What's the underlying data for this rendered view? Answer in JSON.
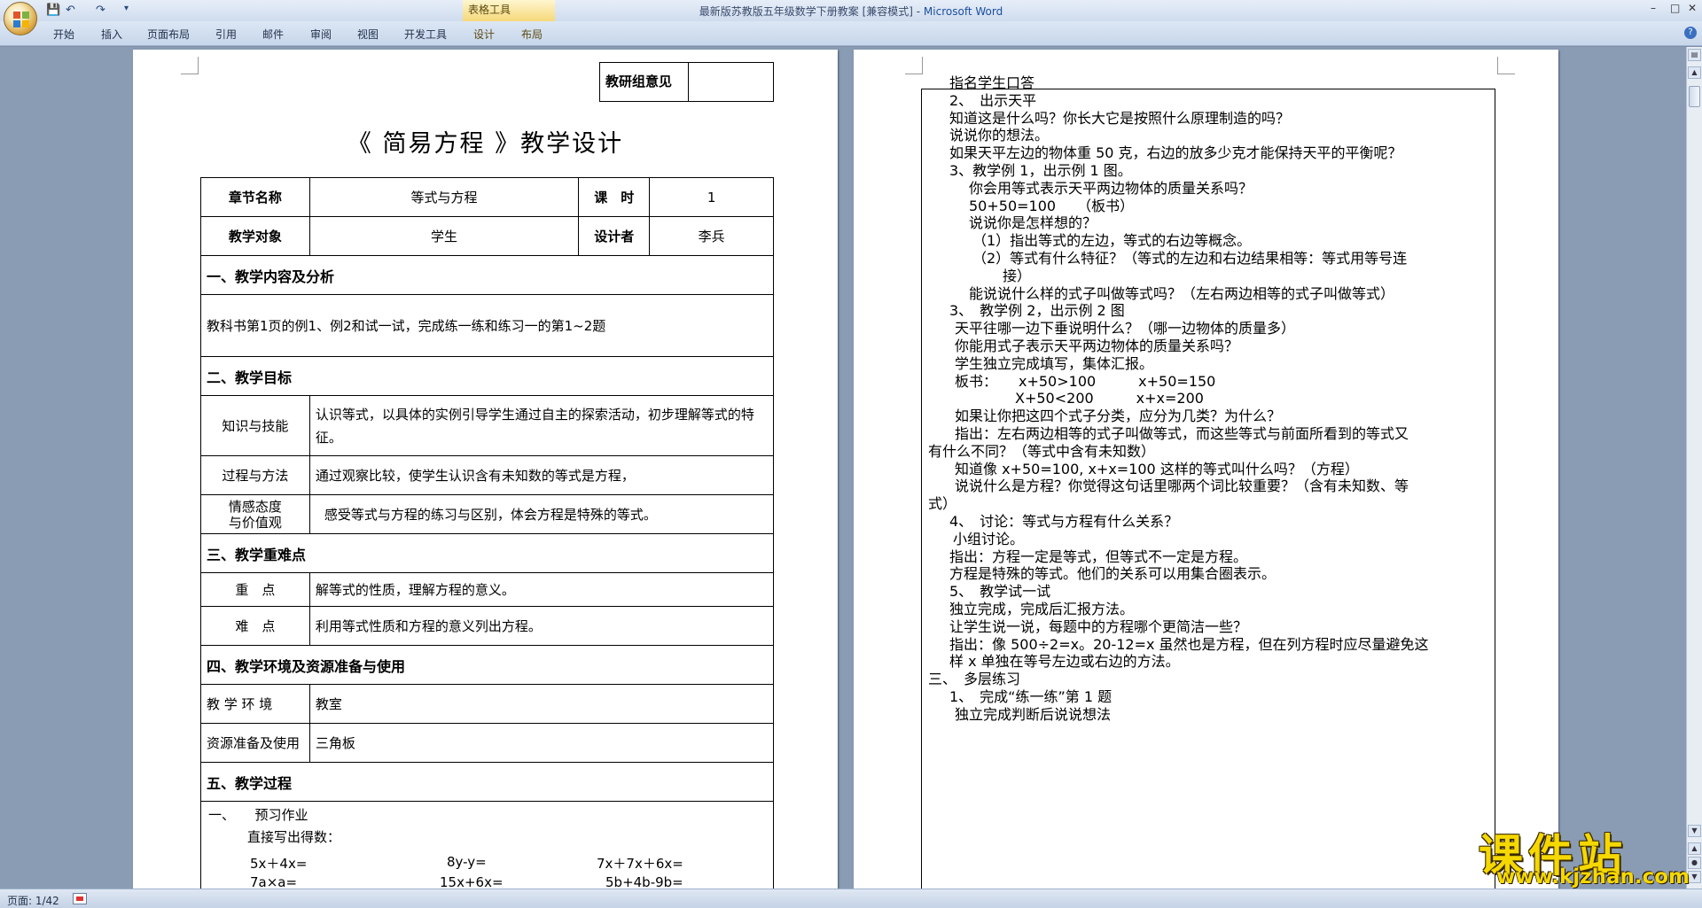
{
  "window": {
    "title_doc": "最新版苏教版五年级数学下册教案 [兼容模式] - ",
    "title_app": "Microsoft Word",
    "context_tab_group": "表格工具"
  },
  "ribbon": {
    "tabs": [
      "开始",
      "插入",
      "页面布局",
      "引用",
      "邮件",
      "审阅",
      "视图",
      "开发工具",
      "设计",
      "布局"
    ]
  },
  "status": {
    "page": "页面: 1/42"
  },
  "page1": {
    "ed_label": "教研组意见",
    "title": "《 简易方程 》教学设计",
    "r1": {
      "k1": "章节名称",
      "v1": "等式与方程",
      "k2": "课　时",
      "v2": "1"
    },
    "r2": {
      "k1": "教学对象",
      "v1": "学生",
      "k2": "设计者",
      "v2": "李兵"
    },
    "s1": "一、教学内容及分析",
    "s1_text": "教科书第1页的例1、例2和试一试，完成练一练和练习一的第1~2题",
    "s2": "二、教学目标",
    "g1_k": "知识与技能",
    "g1_v": "认识等式，以具体的实例引导学生通过自主的探索活动，初步理解等式的特征。",
    "g2_k": "过程与方法",
    "g2_v": "通过观察比较，使学生认识含有未知数的等式是方程，",
    "g3_k1": "情感态度",
    "g3_k2": "与价值观",
    "g3_v": "感受等式与方程的练习与区别，体会方程是特殊的等式。",
    "s3": "三、教学重难点",
    "d1_k": "重　点",
    "d1_v": "解等式的性质，理解方程的意义。",
    "d2_k": "难　点",
    "d2_v": "利用等式性质和方程的意义列出方程。",
    "s4": "四、教学环境及资源准备与使用",
    "e1_k": "教 学 环 境",
    "e1_v": "教室",
    "e2_k": "资源准备及使用",
    "e2_v": "三角板",
    "s5": "五、教学过程",
    "pre": "一、　　预习作业",
    "pre2": "直接写出得数：",
    "ex": [
      "5x＋4x=",
      "8y-y=",
      "7x＋7x＋6x=",
      "7a×a=",
      "15x+6x=",
      "5b+4b-9b="
    ]
  },
  "page2": {
    "lines": [
      "指名学生口答",
      "2、　出示天平",
      "知道这是什么吗？你长大它是按照什么原理制造的吗？",
      "说说你的想法。",
      "如果天平左边的物体重 50 克，右边的放多少克才能保持天平的平衡呢？",
      "3、教学例 1，出示例 1 图。",
      "你会用等式表示天平两边物体的质量关系吗？",
      "50+50=100　　（板书）",
      "说说你是怎样想的？",
      "（1）指出等式的左边，等式的右边等概念。",
      "（2）等式有什么特征？（等式的左边和右边结果相等：等式用等号连",
      "接）",
      "能说说什么样的式子叫做等式吗？（左右两边相等的式子叫做等式）",
      "3、　教学例 2，出示例 2 图",
      "天平往哪一边下垂说明什么？（哪一边物体的质量多）",
      "你能用式子表示天平两边物体的质量关系吗？",
      "学生独立完成填写，集体汇报。",
      "板书：　　x+50>100　　　x+50=150",
      "X+50<200　　　x+x=200",
      "如果让你把这四个式子分类，应分为几类？为什么？",
      "指出：左右两边相等的式子叫做等式，而这些等式与前面所看到的等式又",
      "有什么不同？（等式中含有未知数）",
      "知道像 x+50=100, x+x=100 这样的等式叫什么吗？（方程）",
      "说说什么是方程？你觉得这句话里哪两个词比较重要？（含有未知数、等",
      "式）",
      "4、　讨论：等式与方程有什么关系？",
      "小组讨论。",
      "指出：方程一定是等式，但等式不一定是方程。",
      "方程是特殊的等式。他们的关系可以用集合圈表示。",
      "5、　教学试一试",
      "独立完成，完成后汇报方法。",
      "让学生说一说，每题中的方程哪个更简洁一些？",
      "指出：像 500÷2=x。20-12=x 虽然也是方程，但在列方程时应尽量避免这",
      "样 x 单独在等号左边或右边的方法。",
      "三、　多层练习",
      "1、　完成“练一练”第 1 题",
      "独立完成判断后说说想法"
    ]
  },
  "watermark": {
    "big": "课件站",
    "url": "www.kjzhan.com"
  }
}
